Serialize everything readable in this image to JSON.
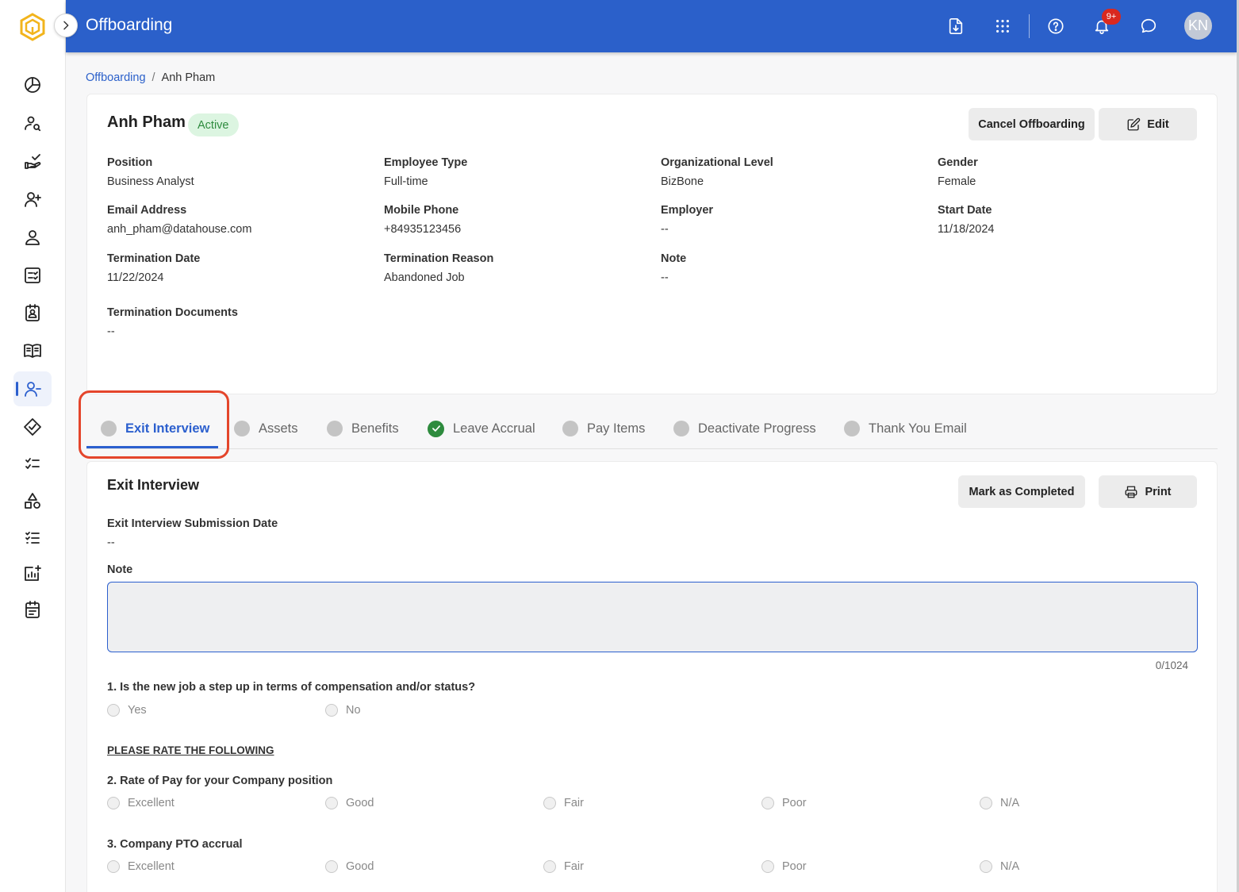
{
  "header": {
    "title": "Offboarding",
    "notification_count": "9+",
    "user_initials": "KN"
  },
  "breadcrumb": {
    "parent": "Offboarding",
    "separator": "/",
    "current": "Anh Pham"
  },
  "employee": {
    "name": "Anh Pham",
    "status": "Active",
    "cancel_label": "Cancel Offboarding",
    "edit_label": "Edit",
    "fields": [
      {
        "label": "Position",
        "value": "Business Analyst"
      },
      {
        "label": "Employee Type",
        "value": "Full-time"
      },
      {
        "label": "Organizational Level",
        "value": "BizBone"
      },
      {
        "label": "Gender",
        "value": "Female"
      },
      {
        "label": "Email Address",
        "value": "anh_pham@datahouse.com"
      },
      {
        "label": "Mobile Phone",
        "value": "+84935123456"
      },
      {
        "label": "Employer",
        "value": "--"
      },
      {
        "label": "Start Date",
        "value": "11/18/2024"
      },
      {
        "label": "Termination Date",
        "value": "11/22/2024"
      },
      {
        "label": "Termination Reason",
        "value": "Abandoned Job"
      },
      {
        "label": "Note",
        "value": "--"
      },
      {
        "label": "Termination Documents",
        "value": "--"
      }
    ]
  },
  "tabs": [
    {
      "label": "Exit Interview",
      "state": "active"
    },
    {
      "label": "Assets",
      "state": "pending"
    },
    {
      "label": "Benefits",
      "state": "pending"
    },
    {
      "label": "Leave Accrual",
      "state": "completed"
    },
    {
      "label": "Pay Items",
      "state": "pending"
    },
    {
      "label": "Deactivate Progress",
      "state": "pending"
    },
    {
      "label": "Thank You Email",
      "state": "pending"
    }
  ],
  "exit_interview": {
    "title": "Exit Interview",
    "mark_completed_label": "Mark as Completed",
    "print_label": "Print",
    "submission_label": "Exit Interview Submission Date",
    "submission_value": "--",
    "note_label": "Note",
    "note_value": "",
    "note_counter": "0/1024",
    "q1": {
      "text": "1. Is the new job a step up in terms of compensation and/or status?",
      "options": [
        "Yes",
        "No"
      ]
    },
    "rate_heading": "PLEASE RATE THE FOLLOWING",
    "q2": {
      "text": "2. Rate of Pay for your Company position",
      "options": [
        "Excellent",
        "Good",
        "Fair",
        "Poor",
        "N/A"
      ]
    },
    "q3": {
      "text": "3. Company PTO accrual",
      "options": [
        "Excellent",
        "Good",
        "Fair",
        "Poor",
        "N/A"
      ]
    }
  },
  "colors": {
    "primary": "#2b60ca",
    "active_green": "#2e8b3e",
    "highlight_red": "#e4452b",
    "badge_red": "#d9281f"
  },
  "icons": {
    "rail": [
      "dashboard-icon",
      "candidate-search-icon",
      "hiring-icon",
      "add-user-icon",
      "employee-icon",
      "checklist-icon",
      "contact-card-icon",
      "handbook-icon",
      "offboarding-icon",
      "badge-icon",
      "tasks-icon",
      "shapes-icon",
      "list-icon",
      "report-icon",
      "calendar-icon"
    ],
    "topbar": [
      "download-document-icon",
      "apps-grid-icon",
      "help-icon",
      "bell-icon",
      "chat-icon"
    ]
  }
}
